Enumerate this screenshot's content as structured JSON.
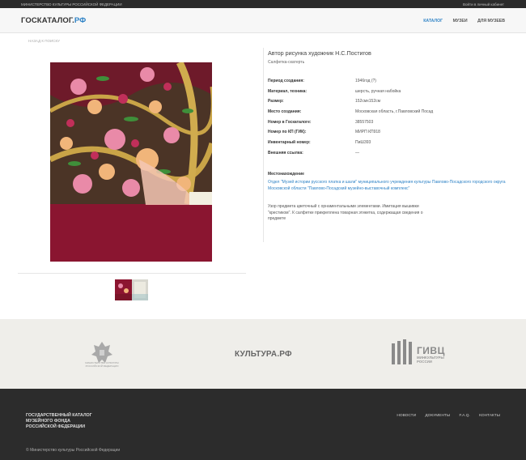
{
  "topbar": {
    "left_text": "МИНИСТЕРСТВО КУЛЬТУРЫ РОССИЙСКОЙ ФЕДЕРАЦИИ",
    "login_link": "Войти в личный кабинет"
  },
  "header": {
    "logo_main": "ГОСКАТАЛОГ.",
    "logo_suffix": "РФ",
    "nav": [
      "КАТАЛОГ",
      "МУЗЕИ",
      "ДЛЯ МУЗЕЕВ"
    ],
    "active_nav": "КАТАЛОГ"
  },
  "breadcrumb": {
    "back_label": "НАЗАД К ПОИСКУ"
  },
  "item": {
    "title": "Автор рисунка художник Н.С.Постигов",
    "subtitle": "Салфетка-скатерть",
    "properties": [
      {
        "label": "Период создания:",
        "value": "1946год (?)"
      },
      {
        "label": "Материал, техника:",
        "value": "шерсть, ручная набойка"
      },
      {
        "label": "Размер:",
        "value": "152смх152см"
      },
      {
        "label": "Место создания:",
        "value": "Московская область, г.Павловский Посад"
      },
      {
        "label": "Номер в Госкаталоге:",
        "value": "38557503"
      },
      {
        "label": "Номер по КП (ГИК):",
        "value": "МИРП КП918"
      },
      {
        "label": "Инвентарный номер:",
        "value": "ПиШ393"
      },
      {
        "label": "Внешняя ссылка:",
        "value": "—"
      }
    ],
    "location_heading": "Местонахождение",
    "location_text": "Отдел \"Музей истории русского платка и шали\" муниципального учреждения культуры Павлово-Посадского городского округа Московской области \"Павлово-Посадский музейно-выставочный комплекс\"",
    "description": "Узор предмета цветочный с орнаментальными элементами. Имитация вышивки \"крестиком\". К салфетке прикреплена товарная этикетка, содержащая сведения о предмете"
  },
  "partners": {
    "ministry_text": "МИНИСТЕРСТВО КУЛЬТУРЫ РОССИЙСКОЙ ФЕДЕРАЦИИ",
    "kultura_logo": "КУЛЬТУРА.РФ",
    "givc_title": "ГИВЦ",
    "givc_sub1": "МИНКУЛЬТУРЫ",
    "givc_sub2": "РОССИИ"
  },
  "footer": {
    "title_lines": [
      "ГОСУДАРСТВЕННЫЙ КАТАЛОГ",
      "МУЗЕЙНОГО ФОНДА",
      "РОССИЙСКОЙ ФЕДЕРАЦИИ"
    ],
    "nav": [
      "НОВОСТИ",
      "ДОКУМЕНТЫ",
      "F.A.Q.",
      "КОНТАКТЫ"
    ],
    "copyright": "© Министерство культуры Российской Федерации"
  },
  "colors": {
    "accent": "#2f83c6",
    "dark": "#2c2c2c",
    "partners_bg": "#efeeea",
    "fabric": "#8c1530"
  }
}
